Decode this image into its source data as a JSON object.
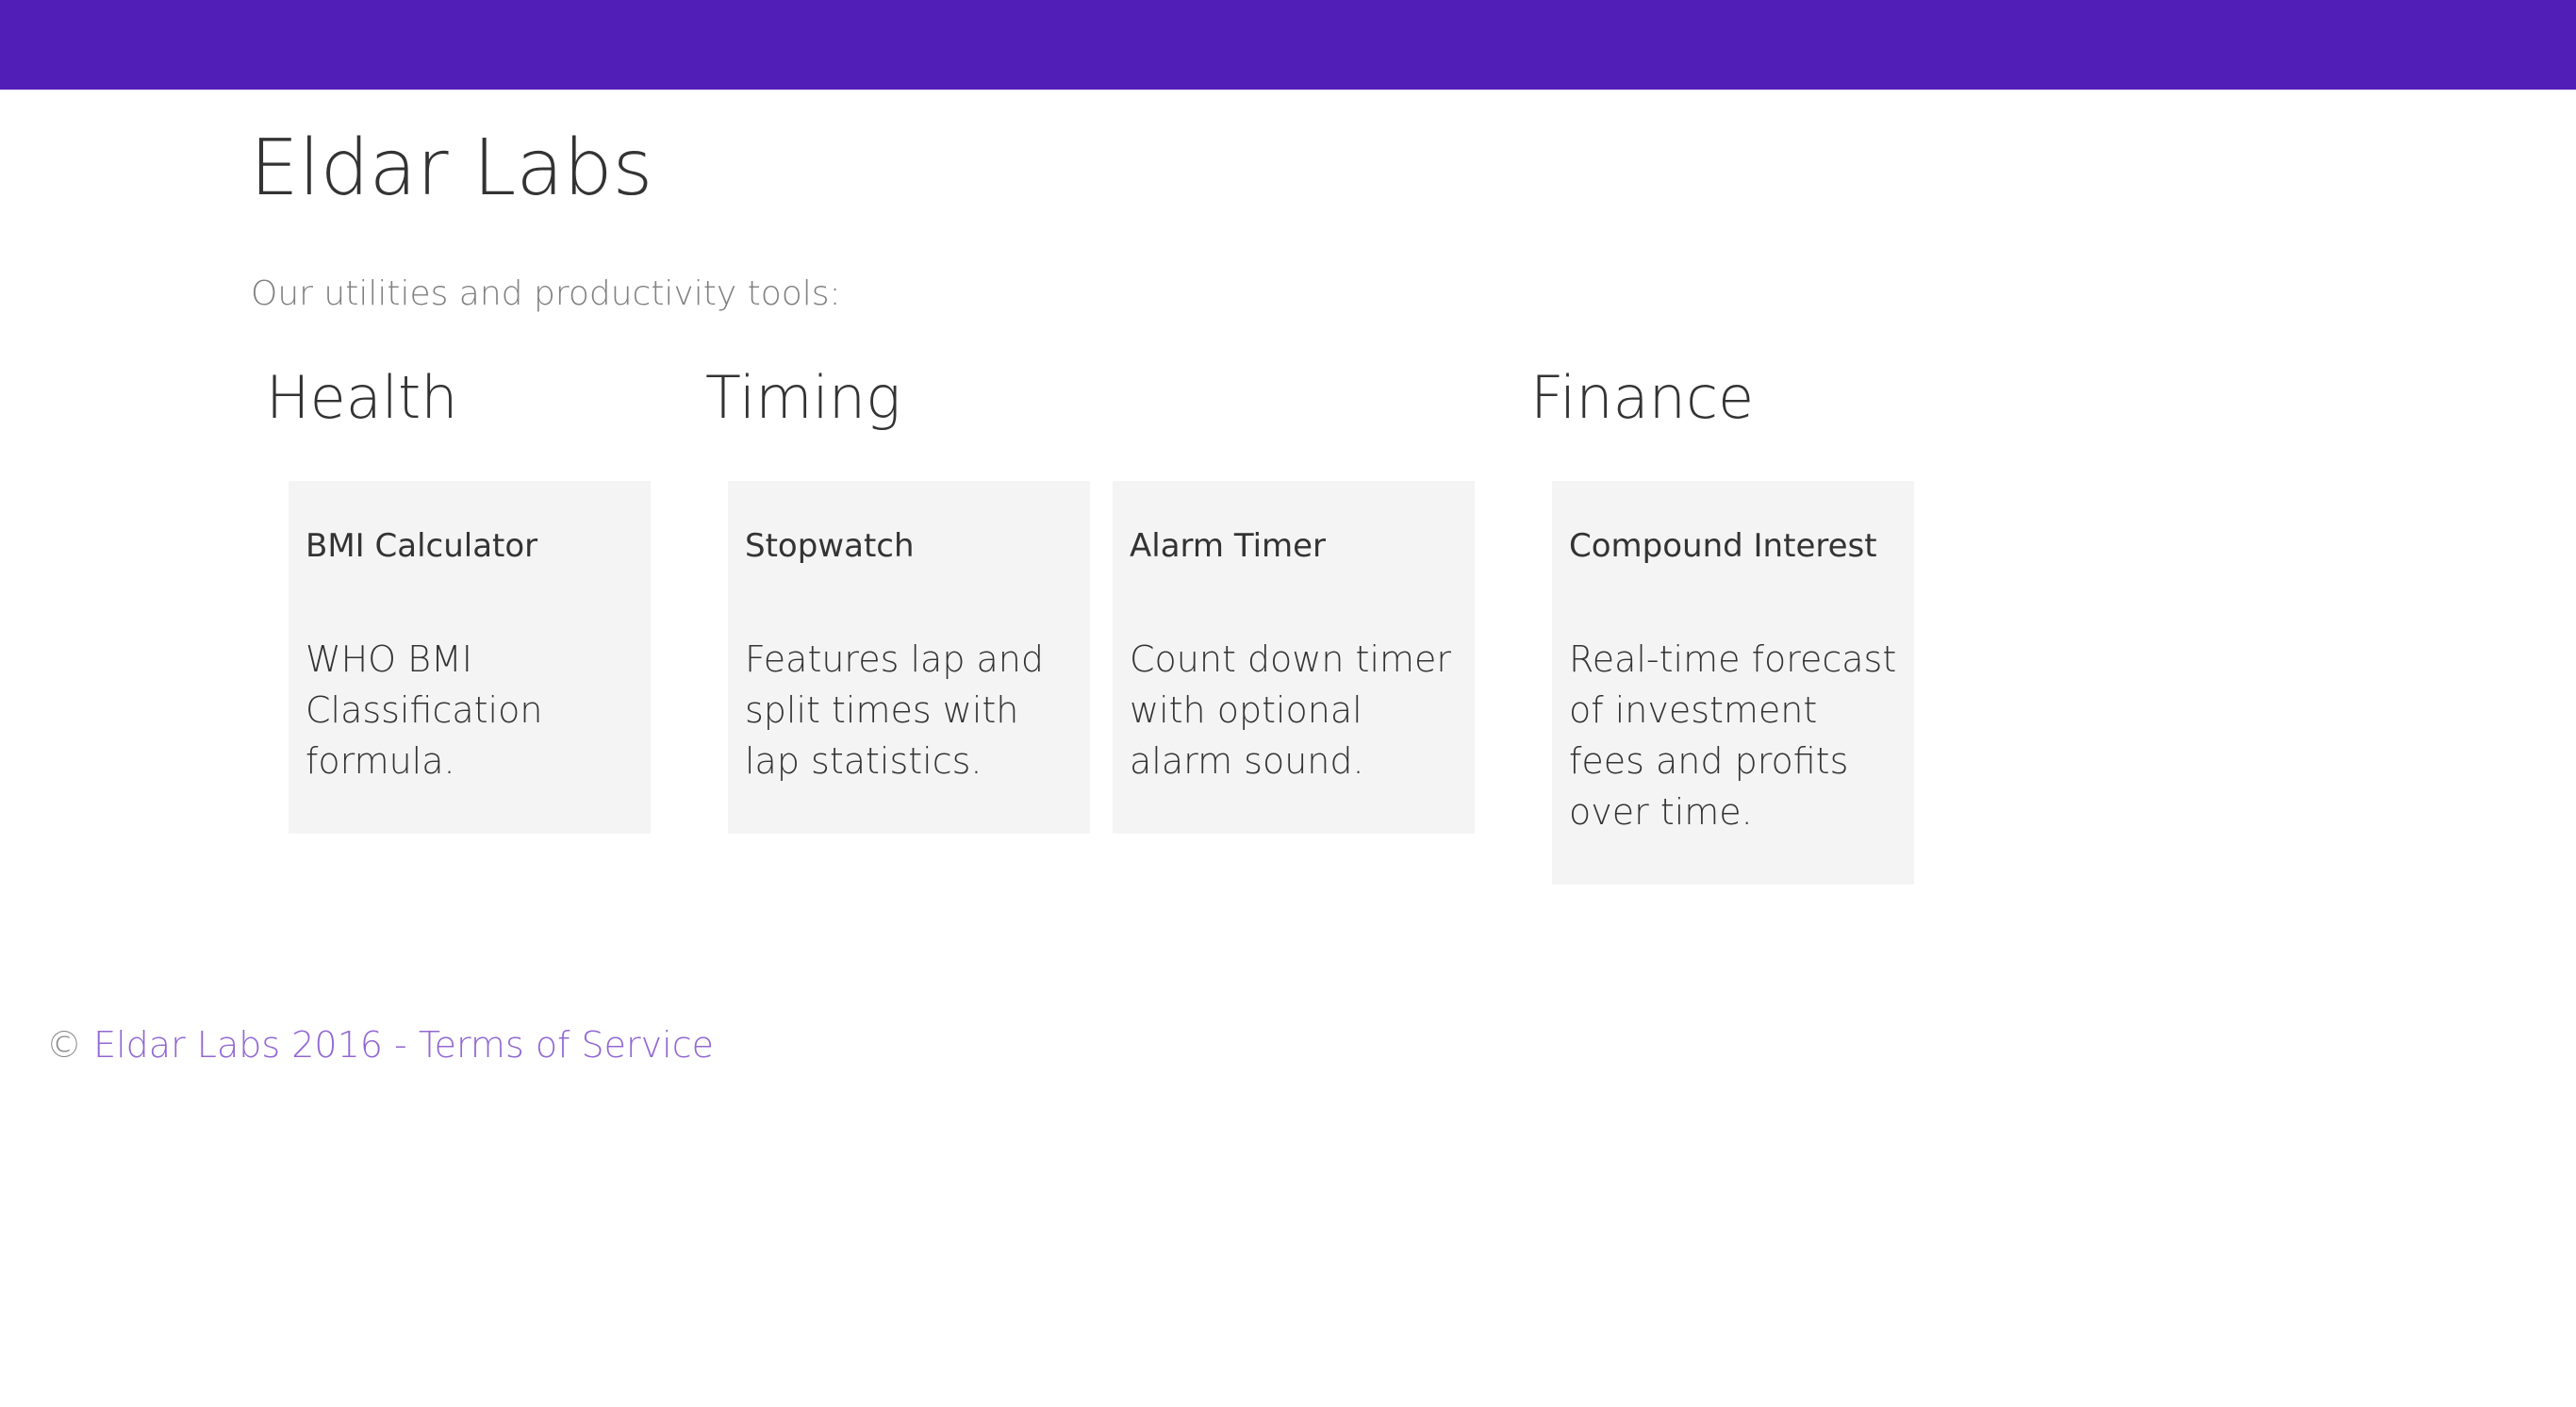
{
  "colors": {
    "brand": "#521eb8",
    "link": "#9167d2",
    "card_bg": "#f4f4f4",
    "text": "#333333",
    "muted": "#808080"
  },
  "header": {
    "title": "Eldar Labs",
    "intro": "Our utilities and productivity tools:"
  },
  "categories": [
    {
      "label": "Health"
    },
    {
      "label": "Timing"
    },
    {
      "label": "Finance"
    }
  ],
  "tools": [
    {
      "title": "BMI Calculator",
      "description": "WHO BMI Classification formula."
    },
    {
      "title": "Stopwatch",
      "description": "Features lap and split times with lap statistics."
    },
    {
      "title": "Alarm Timer",
      "description": "Count down timer with optional alarm sound."
    },
    {
      "title": "Compound Interest",
      "description": "Real-time forecast of investment fees and profits over time."
    }
  ],
  "footer": {
    "copyright_symbol": "©",
    "copyright_link": "Eldar Labs 2016",
    "separator": "-",
    "terms_link": "Terms of Service"
  }
}
